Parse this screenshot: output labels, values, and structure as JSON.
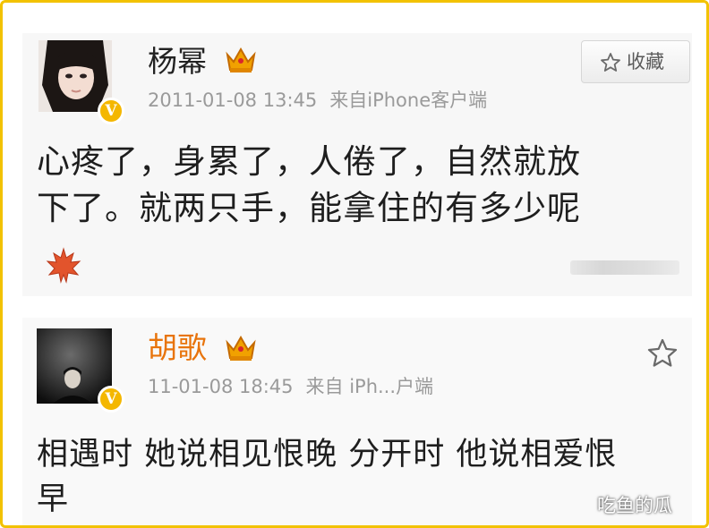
{
  "posts": [
    {
      "username": "杨幂",
      "timestamp": "2011-01-08 13:45",
      "source": "来自iPhone客户端",
      "favorite_label": "收藏",
      "content_line1": "心疼了，身累了，人倦了，自然就放",
      "content_line2": "下了。就两只手，能拿住的有多少呢",
      "verified_mark": "V"
    },
    {
      "username": "胡歌",
      "timestamp": "11-01-08 18:45",
      "source": "来自 iPh...户端",
      "content_line1": "相遇时 她说相见恨晚 分开时 他说相爱恨",
      "content_line2": "早",
      "verified_mark": "V"
    }
  ],
  "watermark": "吃鱼的瓜",
  "colors": {
    "border": "#f2c200",
    "verified": "#f4b700",
    "vip_name": "#e8740c",
    "meta": "#9a9a9a"
  },
  "icons": [
    "crown-icon",
    "star-icon",
    "maple-leaf-icon",
    "verified-badge-icon"
  ]
}
